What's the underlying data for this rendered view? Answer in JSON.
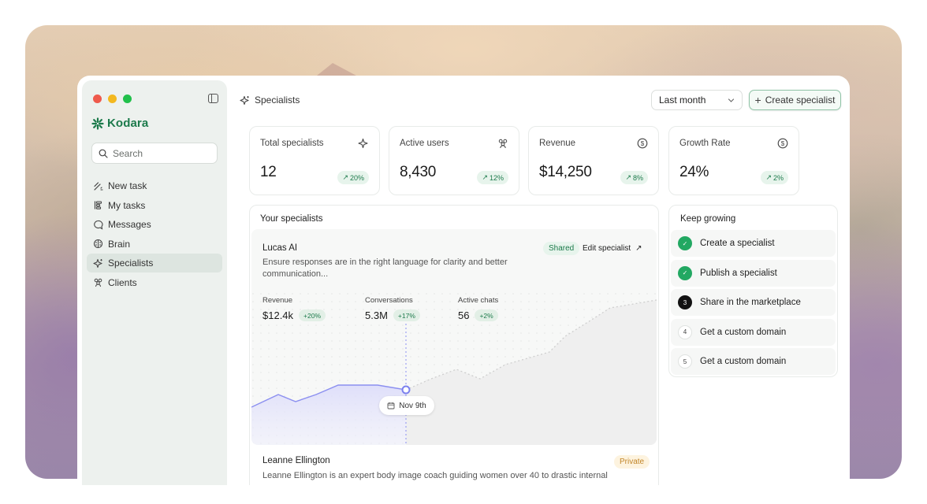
{
  "app": {
    "name": "Kodara"
  },
  "search": {
    "placeholder": "Search"
  },
  "nav": {
    "items": [
      {
        "label": "New task",
        "icon": "pen-sparkle-icon"
      },
      {
        "label": "My tasks",
        "icon": "tasks-icon"
      },
      {
        "label": "Messages",
        "icon": "chat-icon"
      },
      {
        "label": "Brain",
        "icon": "brain-icon"
      },
      {
        "label": "Specialists",
        "icon": "sparkle-icon",
        "active": true
      },
      {
        "label": "Clients",
        "icon": "users-icon"
      }
    ]
  },
  "header": {
    "title": "Specialists",
    "period": "Last month",
    "create_label": "Create specialist"
  },
  "stats": [
    {
      "label": "Total specialists",
      "value": "12",
      "change": "20%",
      "icon": "sparkle-icon"
    },
    {
      "label": "Active users",
      "value": "8,430",
      "change": "12%",
      "icon": "users-icon"
    },
    {
      "label": "Revenue",
      "value": "$14,250",
      "change": "8%",
      "icon": "dollar-icon"
    },
    {
      "label": "Growth Rate",
      "value": "24%",
      "change": "2%",
      "icon": "dollar-icon"
    }
  ],
  "specialists_panel": {
    "title": "Your specialists",
    "items": [
      {
        "name": "Lucas AI",
        "badge": "Shared",
        "action": "Edit specialist",
        "description": "Ensure responses are in the right language for clarity and better communication...",
        "metrics": [
          {
            "label": "Revenue",
            "value": "$12.4k",
            "change": "+20%"
          },
          {
            "label": "Conversations",
            "value": "5.3M",
            "change": "+17%"
          },
          {
            "label": "Active chats",
            "value": "56",
            "change": "+2%"
          }
        ],
        "chart_date": "Nov 9th"
      },
      {
        "name": "Leanne Ellington",
        "badge": "Private",
        "description": "Leanne Ellington is an expert body image coach guiding women over 40 to drastic internal"
      }
    ]
  },
  "keep_growing": {
    "title": "Keep growing",
    "steps": [
      {
        "label": "Create a specialist",
        "status": "done",
        "number": ""
      },
      {
        "label": "Publish a specialist",
        "status": "done",
        "number": ""
      },
      {
        "label": "Share in the marketplace",
        "status": "current",
        "number": "3"
      },
      {
        "label": "Get a custom domain",
        "status": "todo",
        "number": "4"
      },
      {
        "label": "Get a custom domain",
        "status": "todo",
        "number": "5"
      }
    ]
  },
  "colors": {
    "brand": "#1c7a4b",
    "chart_line": "#8b8ff0",
    "chart_fill": "#e6e7fb"
  }
}
